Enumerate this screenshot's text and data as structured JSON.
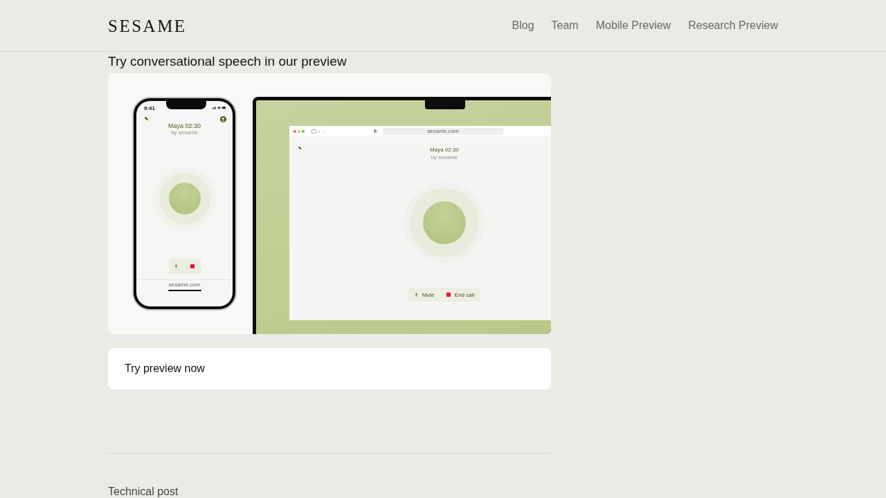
{
  "header": {
    "logo": "SESAME",
    "nav": [
      {
        "label": "Blog"
      },
      {
        "label": "Team"
      },
      {
        "label": "Mobile Preview"
      },
      {
        "label": "Research Preview"
      }
    ]
  },
  "section": {
    "heading": "Try conversational speech in our preview",
    "preview_image": {
      "phone": {
        "time": "9:41",
        "title": "Maya 02:30",
        "subtitle": "by sesame",
        "url": "sesame.com",
        "controls": [
          {
            "kind": "mic"
          },
          {
            "kind": "stop"
          }
        ]
      },
      "desktop": {
        "url": "sesame.com",
        "title": "Maya 02:30",
        "subtitle": "by sesame",
        "controls": [
          {
            "kind": "mic",
            "label": "Mute"
          },
          {
            "kind": "stop",
            "label": "End call"
          }
        ]
      }
    },
    "cta": "Try preview now"
  },
  "next_section": {
    "label": "Technical post"
  }
}
